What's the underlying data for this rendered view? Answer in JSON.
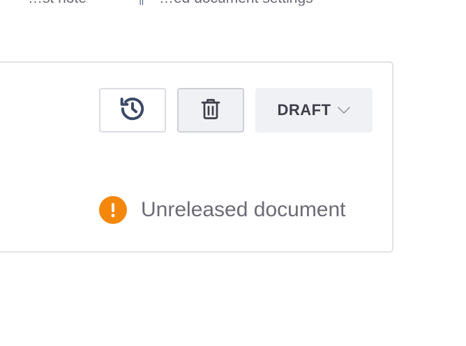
{
  "top_text": {
    "part1": "…st note",
    "part2": "¶",
    "part3": "…ed document settings"
  },
  "toolbar": {
    "history_icon": "history-icon",
    "delete_icon": "trash-icon",
    "status_label": "DRAFT",
    "status_chevron_icon": "chevron-down-icon"
  },
  "notice": {
    "icon": "exclamation-circle-icon",
    "text": "Unreleased document",
    "color": "#f5870b"
  },
  "colors": {
    "text_muted": "#6b6b76",
    "button_bg": "#f0f1f4",
    "border": "#e1e2e6",
    "icon_dark": "#3a4a66"
  }
}
